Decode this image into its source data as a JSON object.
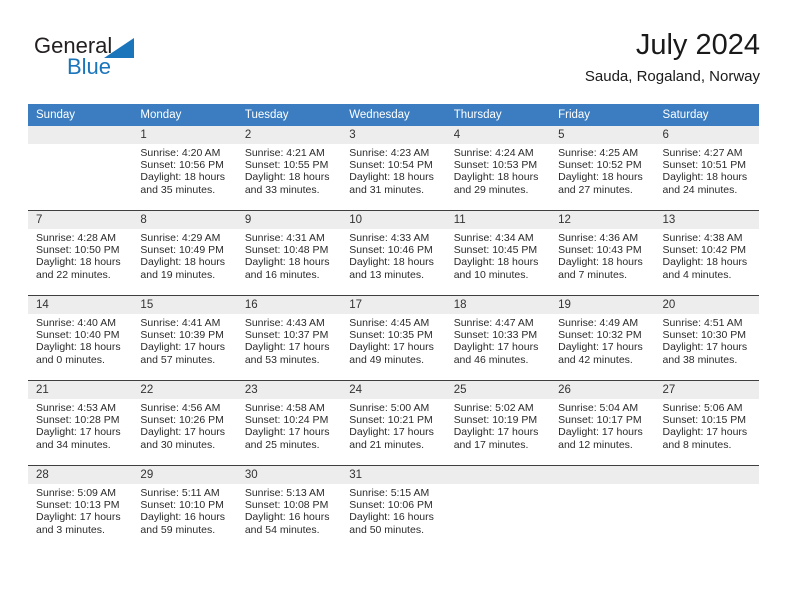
{
  "brand": {
    "name_part1": "General",
    "name_part2": "Blue",
    "triangle_color": "#1b75bb"
  },
  "header": {
    "title": "July 2024",
    "subtitle": "Sauda, Rogaland, Norway",
    "header_bg_color": "#3b7dc0",
    "daynum_bg_color": "#ededed"
  },
  "weekday_headers": [
    "Sunday",
    "Monday",
    "Tuesday",
    "Wednesday",
    "Thursday",
    "Friday",
    "Saturday"
  ],
  "weeks": [
    {
      "days": [
        {
          "num": "",
          "sunrise": "",
          "sunset": "",
          "daylight_line1": "",
          "daylight_line2": "",
          "empty": true
        },
        {
          "num": "1",
          "sunrise": "Sunrise: 4:20 AM",
          "sunset": "Sunset: 10:56 PM",
          "daylight_line1": "Daylight: 18 hours",
          "daylight_line2": "and 35 minutes."
        },
        {
          "num": "2",
          "sunrise": "Sunrise: 4:21 AM",
          "sunset": "Sunset: 10:55 PM",
          "daylight_line1": "Daylight: 18 hours",
          "daylight_line2": "and 33 minutes."
        },
        {
          "num": "3",
          "sunrise": "Sunrise: 4:23 AM",
          "sunset": "Sunset: 10:54 PM",
          "daylight_line1": "Daylight: 18 hours",
          "daylight_line2": "and 31 minutes."
        },
        {
          "num": "4",
          "sunrise": "Sunrise: 4:24 AM",
          "sunset": "Sunset: 10:53 PM",
          "daylight_line1": "Daylight: 18 hours",
          "daylight_line2": "and 29 minutes."
        },
        {
          "num": "5",
          "sunrise": "Sunrise: 4:25 AM",
          "sunset": "Sunset: 10:52 PM",
          "daylight_line1": "Daylight: 18 hours",
          "daylight_line2": "and 27 minutes."
        },
        {
          "num": "6",
          "sunrise": "Sunrise: 4:27 AM",
          "sunset": "Sunset: 10:51 PM",
          "daylight_line1": "Daylight: 18 hours",
          "daylight_line2": "and 24 minutes."
        }
      ]
    },
    {
      "days": [
        {
          "num": "7",
          "sunrise": "Sunrise: 4:28 AM",
          "sunset": "Sunset: 10:50 PM",
          "daylight_line1": "Daylight: 18 hours",
          "daylight_line2": "and 22 minutes."
        },
        {
          "num": "8",
          "sunrise": "Sunrise: 4:29 AM",
          "sunset": "Sunset: 10:49 PM",
          "daylight_line1": "Daylight: 18 hours",
          "daylight_line2": "and 19 minutes."
        },
        {
          "num": "9",
          "sunrise": "Sunrise: 4:31 AM",
          "sunset": "Sunset: 10:48 PM",
          "daylight_line1": "Daylight: 18 hours",
          "daylight_line2": "and 16 minutes."
        },
        {
          "num": "10",
          "sunrise": "Sunrise: 4:33 AM",
          "sunset": "Sunset: 10:46 PM",
          "daylight_line1": "Daylight: 18 hours",
          "daylight_line2": "and 13 minutes."
        },
        {
          "num": "11",
          "sunrise": "Sunrise: 4:34 AM",
          "sunset": "Sunset: 10:45 PM",
          "daylight_line1": "Daylight: 18 hours",
          "daylight_line2": "and 10 minutes."
        },
        {
          "num": "12",
          "sunrise": "Sunrise: 4:36 AM",
          "sunset": "Sunset: 10:43 PM",
          "daylight_line1": "Daylight: 18 hours",
          "daylight_line2": "and 7 minutes."
        },
        {
          "num": "13",
          "sunrise": "Sunrise: 4:38 AM",
          "sunset": "Sunset: 10:42 PM",
          "daylight_line1": "Daylight: 18 hours",
          "daylight_line2": "and 4 minutes."
        }
      ]
    },
    {
      "days": [
        {
          "num": "14",
          "sunrise": "Sunrise: 4:40 AM",
          "sunset": "Sunset: 10:40 PM",
          "daylight_line1": "Daylight: 18 hours",
          "daylight_line2": "and 0 minutes."
        },
        {
          "num": "15",
          "sunrise": "Sunrise: 4:41 AM",
          "sunset": "Sunset: 10:39 PM",
          "daylight_line1": "Daylight: 17 hours",
          "daylight_line2": "and 57 minutes."
        },
        {
          "num": "16",
          "sunrise": "Sunrise: 4:43 AM",
          "sunset": "Sunset: 10:37 PM",
          "daylight_line1": "Daylight: 17 hours",
          "daylight_line2": "and 53 minutes."
        },
        {
          "num": "17",
          "sunrise": "Sunrise: 4:45 AM",
          "sunset": "Sunset: 10:35 PM",
          "daylight_line1": "Daylight: 17 hours",
          "daylight_line2": "and 49 minutes."
        },
        {
          "num": "18",
          "sunrise": "Sunrise: 4:47 AM",
          "sunset": "Sunset: 10:33 PM",
          "daylight_line1": "Daylight: 17 hours",
          "daylight_line2": "and 46 minutes."
        },
        {
          "num": "19",
          "sunrise": "Sunrise: 4:49 AM",
          "sunset": "Sunset: 10:32 PM",
          "daylight_line1": "Daylight: 17 hours",
          "daylight_line2": "and 42 minutes."
        },
        {
          "num": "20",
          "sunrise": "Sunrise: 4:51 AM",
          "sunset": "Sunset: 10:30 PM",
          "daylight_line1": "Daylight: 17 hours",
          "daylight_line2": "and 38 minutes."
        }
      ]
    },
    {
      "days": [
        {
          "num": "21",
          "sunrise": "Sunrise: 4:53 AM",
          "sunset": "Sunset: 10:28 PM",
          "daylight_line1": "Daylight: 17 hours",
          "daylight_line2": "and 34 minutes."
        },
        {
          "num": "22",
          "sunrise": "Sunrise: 4:56 AM",
          "sunset": "Sunset: 10:26 PM",
          "daylight_line1": "Daylight: 17 hours",
          "daylight_line2": "and 30 minutes."
        },
        {
          "num": "23",
          "sunrise": "Sunrise: 4:58 AM",
          "sunset": "Sunset: 10:24 PM",
          "daylight_line1": "Daylight: 17 hours",
          "daylight_line2": "and 25 minutes."
        },
        {
          "num": "24",
          "sunrise": "Sunrise: 5:00 AM",
          "sunset": "Sunset: 10:21 PM",
          "daylight_line1": "Daylight: 17 hours",
          "daylight_line2": "and 21 minutes."
        },
        {
          "num": "25",
          "sunrise": "Sunrise: 5:02 AM",
          "sunset": "Sunset: 10:19 PM",
          "daylight_line1": "Daylight: 17 hours",
          "daylight_line2": "and 17 minutes."
        },
        {
          "num": "26",
          "sunrise": "Sunrise: 5:04 AM",
          "sunset": "Sunset: 10:17 PM",
          "daylight_line1": "Daylight: 17 hours",
          "daylight_line2": "and 12 minutes."
        },
        {
          "num": "27",
          "sunrise": "Sunrise: 5:06 AM",
          "sunset": "Sunset: 10:15 PM",
          "daylight_line1": "Daylight: 17 hours",
          "daylight_line2": "and 8 minutes."
        }
      ]
    },
    {
      "days": [
        {
          "num": "28",
          "sunrise": "Sunrise: 5:09 AM",
          "sunset": "Sunset: 10:13 PM",
          "daylight_line1": "Daylight: 17 hours",
          "daylight_line2": "and 3 minutes."
        },
        {
          "num": "29",
          "sunrise": "Sunrise: 5:11 AM",
          "sunset": "Sunset: 10:10 PM",
          "daylight_line1": "Daylight: 16 hours",
          "daylight_line2": "and 59 minutes."
        },
        {
          "num": "30",
          "sunrise": "Sunrise: 5:13 AM",
          "sunset": "Sunset: 10:08 PM",
          "daylight_line1": "Daylight: 16 hours",
          "daylight_line2": "and 54 minutes."
        },
        {
          "num": "31",
          "sunrise": "Sunrise: 5:15 AM",
          "sunset": "Sunset: 10:06 PM",
          "daylight_line1": "Daylight: 16 hours",
          "daylight_line2": "and 50 minutes."
        },
        {
          "num": "",
          "sunrise": "",
          "sunset": "",
          "daylight_line1": "",
          "daylight_line2": "",
          "empty": true
        },
        {
          "num": "",
          "sunrise": "",
          "sunset": "",
          "daylight_line1": "",
          "daylight_line2": "",
          "empty": true
        },
        {
          "num": "",
          "sunrise": "",
          "sunset": "",
          "daylight_line1": "",
          "daylight_line2": "",
          "empty": true
        }
      ]
    }
  ]
}
